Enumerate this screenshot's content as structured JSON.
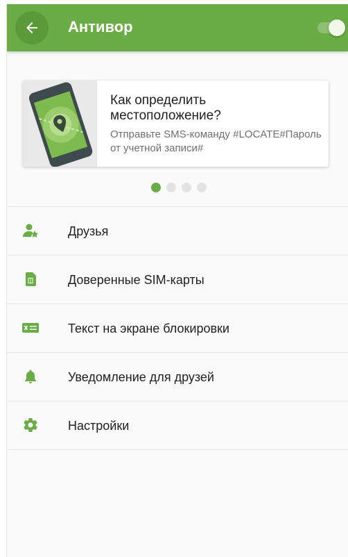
{
  "appbar": {
    "title": "Антивор",
    "toggle_on": true,
    "accent": "#6aac45"
  },
  "card": {
    "title": "Как определить местоположение?",
    "subtitle": "Отправьте SMS-команду #LOCATE#Пароль от учетной записи#"
  },
  "pager": {
    "count": 4,
    "active_index": 0
  },
  "menu": {
    "items": [
      {
        "label": "Друзья",
        "icon": "friends-icon"
      },
      {
        "label": "Доверенные SIM-карты",
        "icon": "sim-card-icon"
      },
      {
        "label": "Текст на экране блокировки",
        "icon": "lock-screen-text-icon"
      },
      {
        "label": "Уведомление для друзей",
        "icon": "bell-icon"
      },
      {
        "label": "Настройки",
        "icon": "gear-icon"
      }
    ]
  }
}
